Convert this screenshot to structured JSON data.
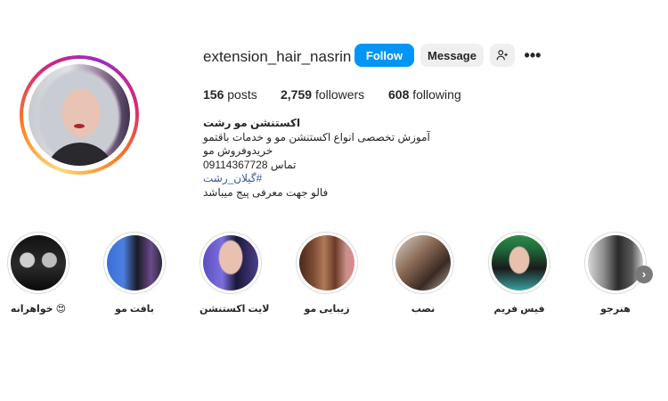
{
  "profile": {
    "username": "extension_hair_nasrin",
    "follow_label": "Follow",
    "message_label": "Message",
    "more_label": "•••",
    "posts_count": "156",
    "posts_label": "posts",
    "followers_count": "2,759",
    "followers_label": "followers",
    "following_count": "608",
    "following_label": "following"
  },
  "bio": {
    "name": "اکستنشن مو رشت",
    "line1": "آموزش تخصصی انواع اکستنشن مو و خدمات باقتمو",
    "line2": "خریدوفروش مو",
    "line3": "تماس 09114367728",
    "hashtag": "#گیلان_رشت",
    "line4": "فالو جهت معرفی پیج میباشد"
  },
  "highlights": [
    {
      "label": "خواهرانه 😍"
    },
    {
      "label": "بافت مو"
    },
    {
      "label": "لایت اکستنشن"
    },
    {
      "label": "زیبایی مو"
    },
    {
      "label": "نصب"
    },
    {
      "label": "فیس فریم"
    },
    {
      "label": "هنرجو"
    }
  ],
  "icons": {
    "add_user": "add-user-icon",
    "more": "more-options-icon",
    "next": "chevron-right-icon"
  },
  "colors": {
    "follow_button": "#0095f6",
    "secondary_button": "#efefef",
    "hashtag": "#385898"
  }
}
